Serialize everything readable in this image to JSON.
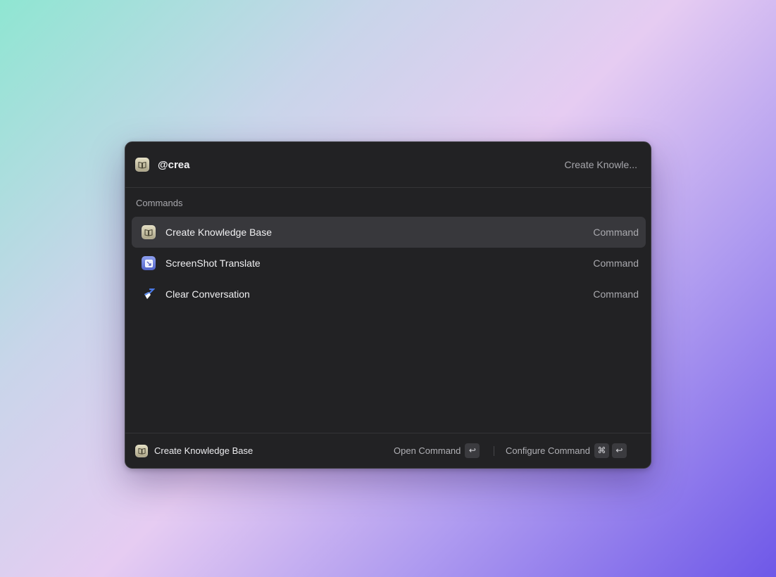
{
  "search": {
    "value": "@crea",
    "hint": "Create Knowle..."
  },
  "section": {
    "title": "Commands"
  },
  "commands": [
    {
      "label": "Create Knowledge Base",
      "type": "Command",
      "icon": "book-icon",
      "selected": true
    },
    {
      "label": "ScreenShot Translate",
      "type": "Command",
      "icon": "screenshot-icon",
      "selected": false
    },
    {
      "label": "Clear Conversation",
      "type": "Command",
      "icon": "broom-icon",
      "selected": false
    }
  ],
  "footer": {
    "selected_label": "Create Knowledge Base",
    "open_label": "Open Command",
    "configure_label": "Configure Command",
    "enter_key": "↩",
    "cmd_key": "⌘"
  },
  "colors": {
    "panel": "#222224",
    "selected_row": "#38383c",
    "accent_gradient": [
      "#8fe6d2",
      "#e6ccf2",
      "#6e58e8"
    ]
  }
}
